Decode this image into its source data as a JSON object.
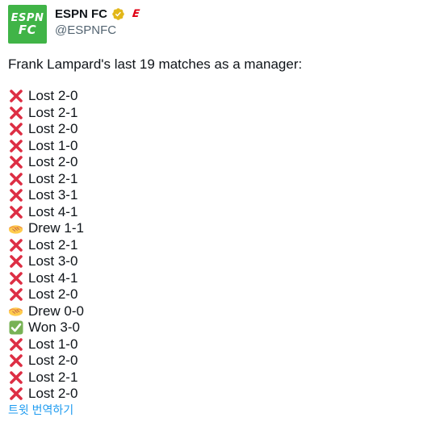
{
  "account": {
    "avatar_line1": "ESPN",
    "avatar_line2": "FC",
    "display_name": "ESPN FC",
    "handle": "@ESPNFC",
    "affiliate_badge": "E"
  },
  "tweet": {
    "intro": "Frank Lampard's last 19 matches as a manager:",
    "results": [
      {
        "icon": "cross-mark-icon",
        "text": "Lost 2-0"
      },
      {
        "icon": "cross-mark-icon",
        "text": "Lost 2-1"
      },
      {
        "icon": "cross-mark-icon",
        "text": "Lost 2-0"
      },
      {
        "icon": "cross-mark-icon",
        "text": "Lost 1-0"
      },
      {
        "icon": "cross-mark-icon",
        "text": "Lost 2-0"
      },
      {
        "icon": "cross-mark-icon",
        "text": "Lost 2-1"
      },
      {
        "icon": "cross-mark-icon",
        "text": "Lost 3-1"
      },
      {
        "icon": "cross-mark-icon",
        "text": "Lost 4-1"
      },
      {
        "icon": "handshake-icon",
        "text": "Drew 1-1"
      },
      {
        "icon": "cross-mark-icon",
        "text": "Lost 2-1"
      },
      {
        "icon": "cross-mark-icon",
        "text": "Lost 3-0"
      },
      {
        "icon": "cross-mark-icon",
        "text": "Lost 4-1"
      },
      {
        "icon": "cross-mark-icon",
        "text": "Lost 2-0"
      },
      {
        "icon": "handshake-icon",
        "text": "Drew 0-0"
      },
      {
        "icon": "check-mark-icon",
        "text": "Won 3-0"
      },
      {
        "icon": "cross-mark-icon",
        "text": "Lost 1-0"
      },
      {
        "icon": "cross-mark-icon",
        "text": "Lost 2-0"
      },
      {
        "icon": "cross-mark-icon",
        "text": "Lost 2-1"
      },
      {
        "icon": "cross-mark-icon",
        "text": "Lost 2-0"
      }
    ],
    "translate_label": "트윗 번역하기"
  },
  "colors": {
    "avatar_bg": "#40b447",
    "verified_gold": "#e2b719",
    "affiliate_red": "#e00014",
    "link_blue": "#1d9bf0",
    "cross_red": "#dd2e44",
    "check_green": "#77b255"
  }
}
